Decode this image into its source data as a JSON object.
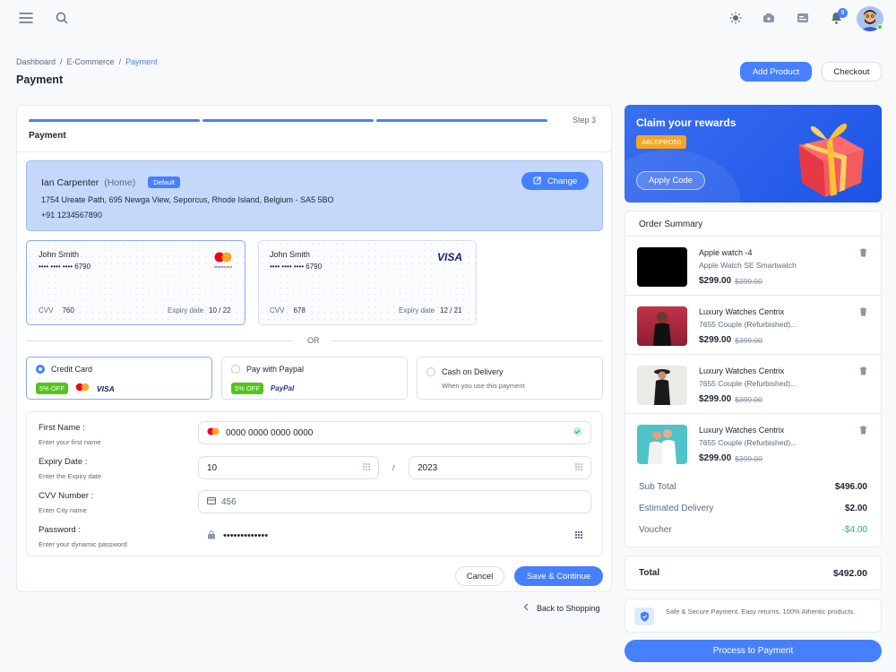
{
  "header": {
    "notif_count": "9"
  },
  "breadcrumb": {
    "items": [
      "Dashboard",
      "E-Commerce",
      "Payment"
    ],
    "sep": "/"
  },
  "page_title": "Payment",
  "actions": {
    "add_product": "Add Product",
    "checkout": "Checkout"
  },
  "steps": {
    "label": "Step 3",
    "title": "Payment"
  },
  "address": {
    "name": "Ian Carpenter",
    "tag": "(Home)",
    "badge": "Default",
    "line": "1754 Ureate Path, 695 Newga View, Seporcus, Rhode Island, Belgium - SA5 5BO",
    "phone": "+91 1234567890",
    "change": "Change"
  },
  "cards": [
    {
      "name": "John Smith",
      "number": "•••• •••• •••• 6790",
      "cvv_label": "CVV",
      "cvv": "760",
      "exp_label": "Expiry date",
      "exp": "10 / 22",
      "brand": "mastercard",
      "brand_text": "Mastercard"
    },
    {
      "name": "John Smith",
      "number": "•••• •••• •••• 6790",
      "cvv_label": "CVV",
      "cvv": "678",
      "exp_label": "Expiry date",
      "exp": "12 / 21",
      "brand": "visa",
      "brand_text": "VISA"
    }
  ],
  "or_label": "OR",
  "methods": [
    {
      "label": "Credit Card",
      "chip": "5% OFF",
      "logo": "VISA",
      "selected": true
    },
    {
      "label": "Pay with Paypal",
      "chip": "5% OFF",
      "logo": "PayPal",
      "selected": false
    },
    {
      "label": "Cash on Delivery",
      "sub": "When you use this payment",
      "selected": false
    }
  ],
  "form": {
    "first_name": {
      "label": "First Name :",
      "help": "Enter your first name",
      "value": "0000 0000 0000 0000"
    },
    "expiry": {
      "label": "Expiry Date :",
      "help": "Enter the Expiry date",
      "month": "10",
      "sep": "/",
      "year": "2023"
    },
    "cvv": {
      "label": "CVV Number :",
      "help": "Enter City name",
      "value": "456"
    },
    "password": {
      "label": "Password :",
      "help": "Enter your dynamic password",
      "value": "•••••••••••••"
    },
    "cancel": "Cancel",
    "save": "Save & Continue"
  },
  "back": "Back to Shopping",
  "rewards": {
    "title": "Claim your rewards",
    "code": "ABLEPRO50",
    "apply": "Apply Code"
  },
  "summary": {
    "title": "Order Summary",
    "items": [
      {
        "name": "Apple watch -4",
        "desc": "Apple Watch SE Smartwatch",
        "price": "$299.00",
        "old": "$399.00"
      },
      {
        "name": "Luxury Watches Centrix",
        "desc": "7655 Couple (Refurbished)...",
        "price": "$299.00",
        "old": "$399.00"
      },
      {
        "name": "Luxury Watches Centrix",
        "desc": "7655 Couple (Refurbished)...",
        "price": "$299.00",
        "old": "$399.00"
      },
      {
        "name": "Luxury Watches Centrix",
        "desc": "7655 Couple (Refurbished)...",
        "price": "$299.00",
        "old": "$399.00"
      }
    ],
    "sub_total_label": "Sub Total",
    "sub_total": "$496.00",
    "delivery_label": "Estimated Delivery",
    "delivery": "$2.00",
    "voucher_label": "Voucher",
    "voucher": "-$4.00",
    "total_label": "Total",
    "total": "$492.00"
  },
  "secure": "Safe & Secure Payment. Easy returns. 100% Athentic products.",
  "process": "Process to Payment",
  "colors": {
    "primary": "#4680ff",
    "success": "#52c41a",
    "danger": "#dc2626",
    "warning": "#f5a623"
  }
}
